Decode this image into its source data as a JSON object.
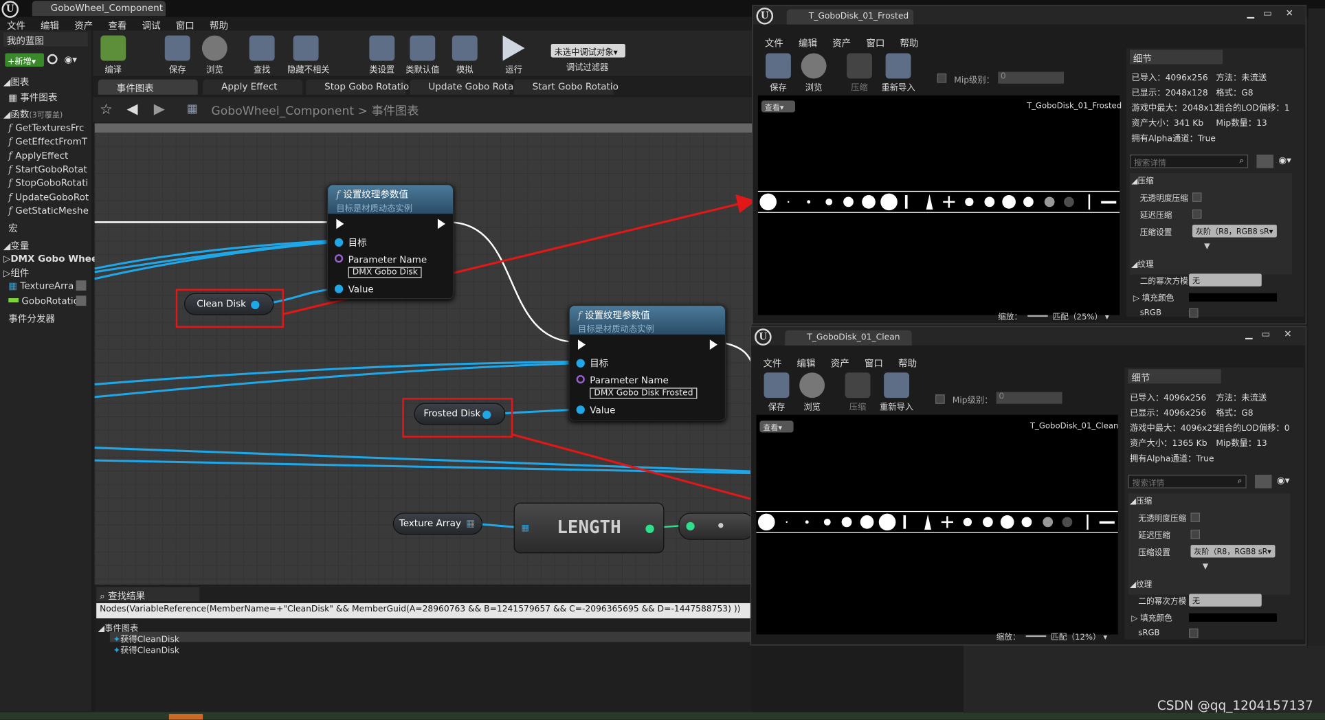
{
  "app": {
    "tab_title": "GoboWheel_Component",
    "menu": [
      "文件",
      "编辑",
      "资产",
      "查看",
      "调试",
      "窗口",
      "帮助"
    ]
  },
  "toolbar": {
    "buttons": [
      {
        "label": "编译",
        "icon": "compile-icon"
      },
      {
        "label": "保存",
        "icon": "save-icon"
      },
      {
        "label": "浏览",
        "icon": "browse-icon"
      },
      {
        "label": "查找",
        "icon": "find-icon"
      },
      {
        "label": "隐藏不相关",
        "icon": "hide-unrelated-icon"
      },
      {
        "label": "类设置",
        "icon": "class-settings-icon"
      },
      {
        "label": "类默认值",
        "icon": "class-defaults-icon"
      },
      {
        "label": "模拟",
        "icon": "simulate-icon"
      },
      {
        "label": "运行",
        "icon": "play-icon"
      }
    ],
    "debug_object": "未选中调试对象",
    "debug_filter": "调试过滤器"
  },
  "my_blueprint": {
    "title": "我的蓝图",
    "new_button": "新增",
    "graphs_label": "图表",
    "event_graph": "事件图表",
    "functions_label": "函数",
    "functions_overrides": "(3可覆盖)",
    "functions": [
      "GetTexturesFrc",
      "GetEffectFromT",
      "ApplyEffect",
      "StartGoboRotat",
      "StopGoboRotati",
      "UpdateGoboRot",
      "GetStaticMeshe"
    ],
    "macros_label": "宏",
    "variables_label": "变量",
    "dmx_category": "DMX Gobo Wheel",
    "components_label": "组件",
    "variables": [
      "TextureArra",
      "GoboRotatio"
    ],
    "event_dispatchers_label": "事件分发器"
  },
  "graph_tabs": [
    "事件图表",
    "Apply Effect",
    "Stop Gobo Rotatio",
    "Update Gobo Rota",
    "Start Gobo Rotatio"
  ],
  "breadcrumb": {
    "root": "GoboWheel_Component",
    "sep": ">",
    "current": "事件图表"
  },
  "nodes": {
    "set_param_1": {
      "title": "设置纹理参数值",
      "subtitle": "目标是材质动态实例",
      "target": "目标",
      "param_name_label": "Parameter Name",
      "param_name": "DMX Gobo Disk",
      "value": "Value"
    },
    "set_param_2": {
      "title": "设置纹理参数值",
      "subtitle": "目标是材质动态实例",
      "target": "目标",
      "param_name_label": "Parameter Name",
      "param_name": "DMX Gobo Disk Frosted",
      "value": "Value"
    },
    "clean_disk": "Clean Disk",
    "frosted_disk": "Frosted Disk",
    "texture_array": "Texture Array",
    "length": "LENGTH"
  },
  "find_results": {
    "title": "查找结果",
    "query": "Nodes(VariableReference(MemberName=+\"CleanDisk\" && MemberGuid(A=28960763 && B=1241579657 && C=-2096365695 && D=-1447588753) ))",
    "group": "事件图表",
    "items": [
      "获得CleanDisk",
      "获得CleanDisk"
    ]
  },
  "texture_windows": [
    {
      "tab": "T_GoboDisk_01_Frosted",
      "menu": [
        "文件",
        "编辑",
        "资产",
        "窗口",
        "帮助"
      ],
      "buttons": [
        "保存",
        "浏览",
        "压缩",
        "重新导入"
      ],
      "mip_label": "Mip级别：",
      "mip_value": "0",
      "view_button": "查看",
      "texture_name": "T_GoboDisk_01_Frosted",
      "zoom_label": "缩放：",
      "zoom_value": "匹配（25%）",
      "details_title": "细节",
      "details": [
        [
          "已导入：4096x256",
          "方法：未流送"
        ],
        [
          "已显示：2048x128",
          "格式：G8"
        ],
        [
          "游戏中最大：2048x12",
          "组合的LOD偏移：1"
        ],
        [
          "资产大小：341 Kb",
          "Mip数量：13"
        ],
        [
          "拥有Alpha通道：True",
          ""
        ]
      ],
      "search_placeholder": "搜索详情",
      "section_compression": "压缩",
      "prop_no_alpha": "无透明度压缩",
      "prop_defer": "延迟压缩",
      "prop_settings": "压缩设置",
      "prop_settings_value": "灰阶（R8，RGB8 sR",
      "section_texture": "纹理",
      "prop_pow2": "二的幂次方模",
      "prop_pow2_value": "无",
      "prop_pad_color": "填充颜色",
      "prop_srgb": "sRGB"
    },
    {
      "tab": "T_GoboDisk_01_Clean",
      "menu": [
        "文件",
        "编辑",
        "资产",
        "窗口",
        "帮助"
      ],
      "buttons": [
        "保存",
        "浏览",
        "压缩",
        "重新导入"
      ],
      "mip_label": "Mip级别：",
      "mip_value": "0",
      "view_button": "查看",
      "texture_name": "T_GoboDisk_01_Clean",
      "zoom_label": "缩放：",
      "zoom_value": "匹配（12%）",
      "details_title": "细节",
      "details": [
        [
          "已导入：4096x256",
          "方法：未流送"
        ],
        [
          "已显示：4096x256",
          "格式：G8"
        ],
        [
          "游戏中最大：4096x25",
          "组合的LOD偏移：0"
        ],
        [
          "资产大小：1365 Kb",
          "Mip数量：13"
        ],
        [
          "拥有Alpha通道：True",
          ""
        ]
      ],
      "search_placeholder": "搜索详情",
      "section_compression": "压缩",
      "prop_no_alpha": "无透明度压缩",
      "prop_defer": "延迟压缩",
      "prop_settings": "压缩设置",
      "prop_settings_value": "灰阶（R8，RGB8 sR",
      "section_texture": "纹理",
      "prop_pow2": "二的幂次方模",
      "prop_pow2_value": "无",
      "prop_pad_color": "填充颜色",
      "prop_srgb": "sRGB"
    }
  ],
  "watermark": "CSDN @qq_1204157137",
  "colors": {
    "wire_blue": "#1fa7e8",
    "annotation_red": "#e21818",
    "node_header": "#3a6a8a"
  }
}
